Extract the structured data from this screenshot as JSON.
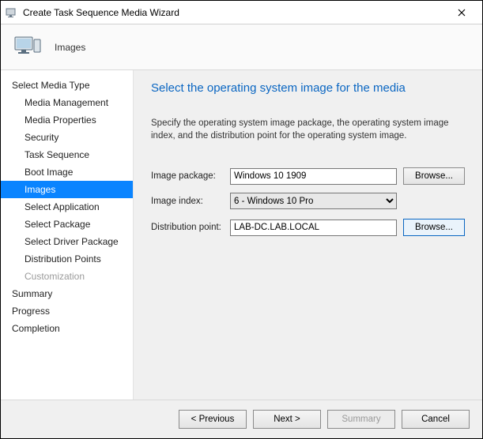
{
  "window": {
    "title": "Create Task Sequence Media Wizard"
  },
  "header": {
    "page_name": "Images"
  },
  "sidebar": {
    "items": [
      {
        "label": "Select Media Type",
        "sub": false,
        "selected": false,
        "disabled": false
      },
      {
        "label": "Media Management",
        "sub": true,
        "selected": false,
        "disabled": false
      },
      {
        "label": "Media Properties",
        "sub": true,
        "selected": false,
        "disabled": false
      },
      {
        "label": "Security",
        "sub": true,
        "selected": false,
        "disabled": false
      },
      {
        "label": "Task Sequence",
        "sub": true,
        "selected": false,
        "disabled": false
      },
      {
        "label": "Boot Image",
        "sub": true,
        "selected": false,
        "disabled": false
      },
      {
        "label": "Images",
        "sub": true,
        "selected": true,
        "disabled": false
      },
      {
        "label": "Select Application",
        "sub": true,
        "selected": false,
        "disabled": false
      },
      {
        "label": "Select Package",
        "sub": true,
        "selected": false,
        "disabled": false
      },
      {
        "label": "Select Driver Package",
        "sub": true,
        "selected": false,
        "disabled": false
      },
      {
        "label": "Distribution Points",
        "sub": true,
        "selected": false,
        "disabled": false
      },
      {
        "label": "Customization",
        "sub": true,
        "selected": false,
        "disabled": true
      },
      {
        "label": "Summary",
        "sub": false,
        "selected": false,
        "disabled": false
      },
      {
        "label": "Progress",
        "sub": false,
        "selected": false,
        "disabled": false
      },
      {
        "label": "Completion",
        "sub": false,
        "selected": false,
        "disabled": false
      }
    ]
  },
  "content": {
    "heading": "Select the operating system image for the media",
    "description": "Specify the operating system image package, the operating system image index, and the distribution point for the operating system image.",
    "image_package_label": "Image package:",
    "image_package_value": "Windows 10 1909",
    "image_package_browse": "Browse...",
    "image_index_label": "Image index:",
    "image_index_value": "6 - Windows 10 Pro",
    "dist_point_label": "Distribution point:",
    "dist_point_value": "LAB-DC.LAB.LOCAL",
    "dist_point_browse": "Browse..."
  },
  "footer": {
    "previous": "< Previous",
    "next": "Next >",
    "summary": "Summary",
    "cancel": "Cancel"
  }
}
